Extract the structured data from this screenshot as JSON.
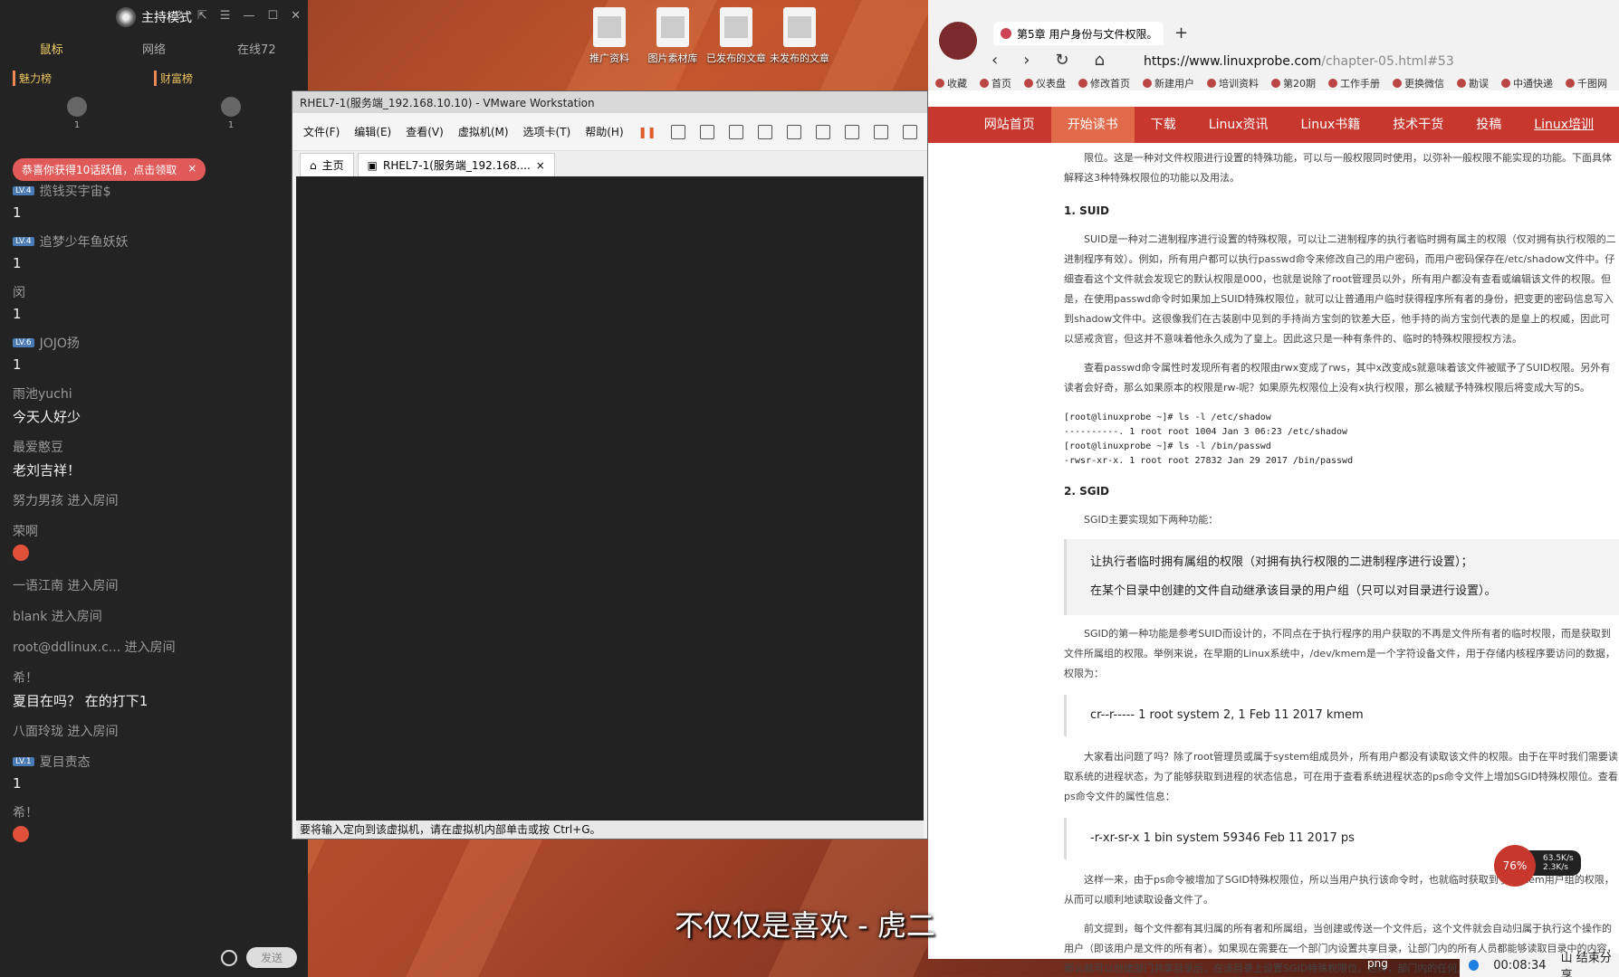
{
  "chat": {
    "mode_label": "主持模式",
    "tabs": [
      "鼠标",
      "网络",
      "在线72"
    ],
    "ranks": [
      "魅力榜",
      "财富榜"
    ],
    "rank_counts": [
      "1",
      "1"
    ],
    "notice": "恭喜你获得10话跃值，点击领取",
    "notice_close": "×",
    "messages": [
      {
        "name": "揽钱买宇宙$",
        "level": "LV.4",
        "text": "1"
      },
      {
        "name": "追梦少年鱼妖妖",
        "level": "LV.4",
        "text": "1"
      },
      {
        "name": "闵",
        "level": "",
        "text": "1"
      },
      {
        "name": "JOJO扬",
        "level": "LV.6",
        "text": "1"
      },
      {
        "name": "雨池yuchi",
        "level": "",
        "text": "今天人好少"
      },
      {
        "name": "最爱憨豆",
        "level": "",
        "text": "老刘吉祥！"
      },
      {
        "name": "努力男孩 进入房间",
        "level": "",
        "text": ""
      },
      {
        "name": "荣啊",
        "level": "",
        "text": ""
      },
      {
        "name": "一语江南 进入房间",
        "level": "",
        "text": ""
      },
      {
        "name": "blank 进入房间",
        "level": "",
        "text": ""
      },
      {
        "name": "root@ddlinux.c... 进入房间",
        "level": "",
        "text": ""
      },
      {
        "name": "希！",
        "level": "",
        "text": "夏目在吗？ 在的打下1"
      },
      {
        "name": "八面玲珑 进入房间",
        "level": "",
        "text": ""
      },
      {
        "name": "夏目责态",
        "level": "LV.1",
        "text": "1"
      },
      {
        "name": "希！",
        "level": "",
        "text": ""
      }
    ],
    "send_label": "发送"
  },
  "desktop": {
    "icons": [
      "推广资料",
      "图片素材库",
      "已发布的文章",
      "未发布的文章"
    ]
  },
  "vmware": {
    "title": "RHEL7-1(服务端_192.168.10.10) - VMware Workstation",
    "menu": [
      "文件(F)",
      "编辑(E)",
      "查看(V)",
      "虚拟机(M)",
      "选项卡(T)",
      "帮助(H)"
    ],
    "tabs": [
      "主页",
      "RHEL7-1(服务端_192.168...."
    ],
    "tab_close": "×",
    "status": "要将输入定向到该虚拟机，请在虚拟机内部单击或按 Ctrl+G。"
  },
  "browser": {
    "tab_title": "第5章 用户身份与文件权限。",
    "new_tab": "+",
    "url_domain": "https://www.linuxprobe.com",
    "url_rest": "/chapter-05.html#53",
    "bookmarks": [
      "收藏",
      "首页",
      "仪表盘",
      "修改首页",
      "新建用户",
      "培训资料",
      "第20期",
      "工作手册",
      "更换微信",
      "勘误",
      "中通快递",
      "千图网"
    ],
    "site_nav": [
      "网站首页",
      "开始读书",
      "下载",
      "Linux资讯",
      "Linux书籍",
      "技术干货",
      "投稿",
      "Linux培训"
    ],
    "intro": "限位。这是一种对文件权限进行设置的特殊功能，可以与一般权限同时使用，以弥补一般权限不能实现的功能。下面具体解释这3种特殊权限位的功能以及用法。",
    "suid_heading": "1. SUID",
    "suid_p1": "SUID是一种对二进制程序进行设置的特殊权限，可以让二进制程序的执行者临时拥有属主的权限（仅对拥有执行权限的二进制程序有效）。例如，所有用户都可以执行passwd命令来修改自己的用户密码，而用户密码保存在/etc/shadow文件中。仔细查看这个文件就会发现它的默认权限是000，也就是说除了root管理员以外，所有用户都没有查看或编辑该文件的权限。但是，在使用passwd命令时如果加上SUID特殊权限位，就可以让普通用户临时获得程序所有者的身份，把变更的密码信息写入到shadow文件中。这很像我们在古装剧中见到的手持尚方宝剑的钦差大臣，他手持的尚方宝剑代表的是皇上的权威，因此可以惩戒贪官，但这并不意味着他永久成为了皇上。因此这只是一种有条件的、临时的特殊权限授权方法。",
    "suid_p2": "查看passwd命令属性时发现所有者的权限由rwx变成了rws，其中x改变成s就意味着该文件被赋予了SUID权限。另外有读者会好奇，那么如果原本的权限是rw-呢？如果原先权限位上没有x执行权限，那么被赋予特殊权限后将变成大写的S。",
    "code1": "[root@linuxprobe ~]# ls -l /etc/shadow\n----------. 1 root root 1004 Jan 3 06:23 /etc/shadow\n[root@linuxprobe ~]# ls -l /bin/passwd\n-rwsr-xr-x. 1 root root 27832 Jan 29 2017 /bin/passwd",
    "sgid_heading": "2. SGID",
    "sgid_intro": "SGID主要实现如下两种功能：",
    "sgid_list": [
      "让执行者临时拥有属组的权限（对拥有执行权限的二进制程序进行设置）；",
      "在某个目录中创建的文件自动继承该目录的用户组（只可以对目录进行设置）。"
    ],
    "sgid_p1": "SGID的第一种功能是参考SUID而设计的，不同点在于执行程序的用户获取的不再是文件所有者的临时权限，而是获取到文件所属组的权限。举例来说，在早期的Linux系统中，/dev/kmem是一个字符设备文件，用于存储内核程序要访问的数据，权限为：",
    "code2": "cr--r----- 1 root system 2, 1 Feb 11 2017 kmem",
    "sgid_p2": "大家看出问题了吗？除了root管理员或属于system组成员外，所有用户都没有读取该文件的权限。由于在平时我们需要读取系统的进程状态，为了能够获取到进程的状态信息，可在用于查看系统进程状态的ps命令文件上增加SGID特殊权限位。查看ps命令文件的属性信息：",
    "code3": "-r-xr-sr-x 1 bin system 59346 Feb 11 2017 ps",
    "sgid_p3": "这样一来，由于ps命令被增加了SGID特殊权限位，所以当用户执行该命令时，也就临时获取到了system用户组的权限，从而可以顺利地读取设备文件了。",
    "sgid_p4": "前文提到，每个文件都有其归属的所有者和所属组，当创建或传送一个文件后，这个文件就会自动归属于执行这个操作的用户（即该用户是文件的所有者）。如果现在需要在一个部门内设置共享目录，让部门内的所有人员都能够读取目录中的内容，那么就可以创建部门共享目录后，在该目录上设置SGID特殊权限位。这样，部门内的任何人员在里面创建的任何文件都会归属于该目录的所属组。"
  },
  "overlay": {
    "subtitle": "不仅仅是喜欢 - 虎二",
    "net_percent": "76%",
    "net_up": "63.5K/s",
    "net_down": "2.3K/s",
    "png_label": "png",
    "timer": "00:08:34",
    "share": "山 结束分享"
  }
}
